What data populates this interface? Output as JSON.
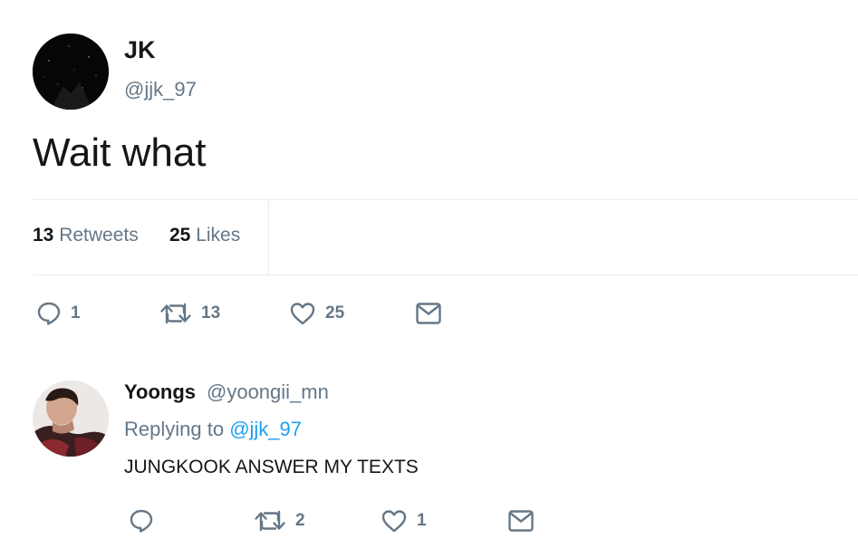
{
  "tweet": {
    "author_name": "JK",
    "author_handle": "@jjk_97",
    "text": "Wait what",
    "retweets_count": "13",
    "retweets_label": "Retweets",
    "likes_count": "25",
    "likes_label": "Likes",
    "actions": {
      "reply_count": "1",
      "retweet_count": "13",
      "like_count": "25"
    }
  },
  "reply": {
    "author_name": "Yoongs",
    "author_handle": "@yoongii_mn",
    "replying_prefix": "Replying to",
    "replying_to": "@jjk_97",
    "text": "JUNGKOOK ANSWER MY TEXTS",
    "actions": {
      "retweet_count": "2",
      "like_count": "1"
    }
  },
  "icons": {
    "reply": "reply-icon",
    "retweet": "retweet-icon",
    "like": "heart-icon",
    "message": "envelope-icon"
  },
  "colors": {
    "text_primary": "#14171a",
    "text_secondary": "#657786",
    "link": "#1da1f2",
    "divider": "#e6ecf0"
  }
}
